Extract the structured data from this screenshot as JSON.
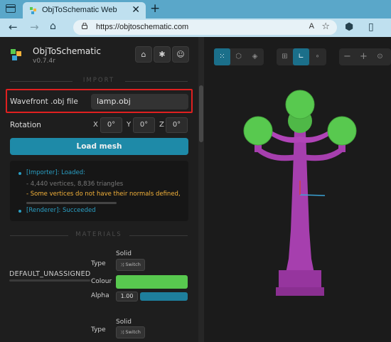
{
  "browser": {
    "tab_title": "ObjToSchematic Web",
    "tab_close": "✕",
    "new_tab": "+",
    "url": "https://objtoschematic.com",
    "read_aloud": "A",
    "nav_back": "←",
    "nav_forward": "→",
    "nav_refresh": "↻",
    "nav_home": "⌂"
  },
  "app": {
    "name": "ObjToSchematic",
    "version": "v0.7.4r",
    "header_icons": [
      "github-icon",
      "bug-icon",
      "discord-icon"
    ]
  },
  "import": {
    "section_title": "IMPORT",
    "file_label": "Wavefront .obj file",
    "file_value": "lamp.obj",
    "rotation_label": "Rotation",
    "rotation": [
      {
        "axis": "X",
        "value": "0°"
      },
      {
        "axis": "Y",
        "value": "0°"
      },
      {
        "axis": "Z",
        "value": "0°"
      }
    ],
    "load_button": "Load mesh"
  },
  "log": {
    "importer_title": "[Importer]: Loaded:",
    "importer_detail": "- 4,440 vertices, 8,836 triangles",
    "importer_warning": "- Some vertices do not have their normals defined,",
    "renderer_title": "[Renderer]: Succeeded"
  },
  "materials": {
    "section_title": "MATERIALS",
    "material_name": "DEFAULT_UNASSIGNED",
    "type_label": "Type",
    "type_value": "Solid",
    "switch_label": "Switch",
    "colour_label": "Colour",
    "colour_value": "#58c94f",
    "alpha_label": "Alpha",
    "alpha_value": "1.00",
    "second_type_label": "Type",
    "second_type_value": "Solid",
    "second_switch_label": "Switch"
  },
  "viewport": {
    "tools_group1": [
      "point-cloud-icon",
      "mesh-icon",
      "voxel-icon"
    ],
    "tools_group2": [
      "grid-icon",
      "axes-icon",
      "dot-icon"
    ],
    "tools_group3": [
      "zoom-out-icon",
      "zoom-in-icon",
      "center-icon"
    ],
    "mesh_colors": {
      "bulbs": "#58c94f",
      "pole": "#a63fae"
    }
  },
  "colors": {
    "accent": "#1e8aa8",
    "browser_tab_bar": "#5aa7c9",
    "warning_text": "#f4b23a",
    "info_text": "#2a9fc4",
    "highlight_border": "#e02020"
  }
}
